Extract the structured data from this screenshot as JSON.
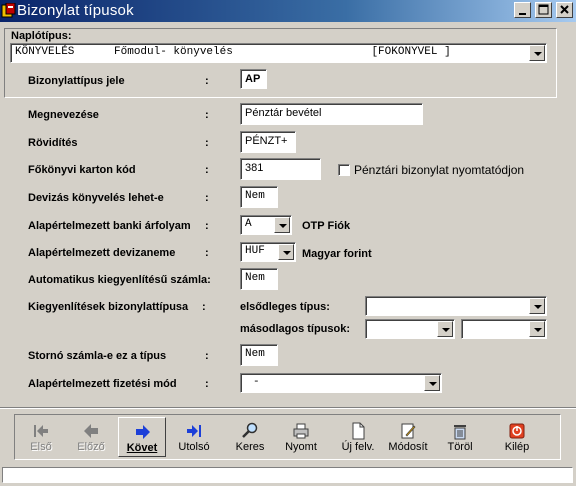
{
  "window": {
    "title": "Bizonylat típusok",
    "minimize": "_",
    "maximize": "□",
    "close": "×"
  },
  "naplo": {
    "label": "Naplótípus:",
    "value": "KÖNYVELÉS      Főmodul- könyvelés                     [FOKONYVEL ]"
  },
  "form": {
    "colon": ":",
    "jel": {
      "label": "Bizonylattípus jele",
      "value": "AP"
    },
    "megnevezes": {
      "label": "Megnevezése",
      "value": "Pénztár bevétel"
    },
    "rovidites": {
      "label": "Rövidítés",
      "value": "PÉNZT+"
    },
    "fokonyvi": {
      "label": "Főkönyvi karton  kód",
      "value": "381",
      "checkbox_label": "Pénztári bizonylat nyomtatódjon"
    },
    "devizas": {
      "label": "Devizás könyvelés lehet-e",
      "value": "Nem"
    },
    "banki": {
      "label": "Alapértelmezett banki árfolyam",
      "value": "A",
      "desc": "OTP Fiók"
    },
    "deviza": {
      "label": "Alapértelmezett devizaneme",
      "value": "HUF",
      "desc": "Magyar forint"
    },
    "auto": {
      "label": "Automatikus kiegyenlítésű számla:",
      "value": "Nem"
    },
    "kiegyenlites": {
      "label": "Kiegyenlítések bizonylattípusa",
      "elso_label": "elsődleges típus:",
      "elso_value": "",
      "masod_label": "másodlagos típusok:",
      "masod_value1": "",
      "masod_value2": ""
    },
    "storno": {
      "label": "Stornó számla-e ez a típus",
      "value": "Nem"
    },
    "fizetesi": {
      "label": "Alapértelmezett fizetési mód",
      "value": "-"
    }
  },
  "toolbar": {
    "buttons": [
      {
        "label": "Első",
        "icon": "first-icon"
      },
      {
        "label": "Előző",
        "icon": "previous-icon"
      },
      {
        "label": "Követ",
        "icon": "next-icon"
      },
      {
        "label": "Utolsó",
        "icon": "last-icon"
      },
      {
        "label": "Keres",
        "icon": "search-icon"
      },
      {
        "label": "Nyomt",
        "icon": "print-icon"
      },
      {
        "label": "Új felv.",
        "icon": "new-record-icon"
      },
      {
        "label": "Módosít",
        "icon": "edit-icon"
      },
      {
        "label": "Töröl",
        "icon": "delete-icon"
      },
      {
        "label": "Kilép",
        "icon": "exit-icon"
      }
    ]
  },
  "status": {
    "text": ""
  }
}
